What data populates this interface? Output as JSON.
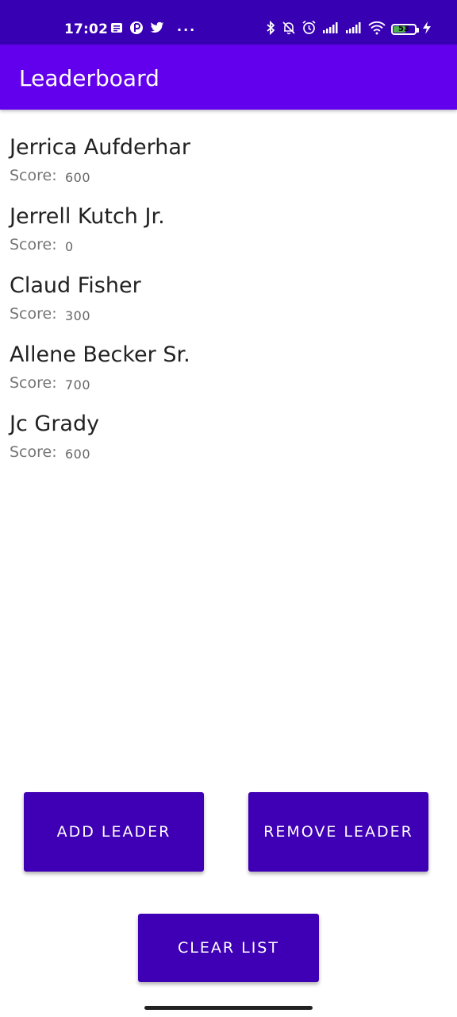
{
  "status_bar": {
    "time": "17:02",
    "battery_level": "53",
    "icons_left": [
      "notes-icon",
      "app-icon",
      "twitter-icon",
      "more-icon"
    ],
    "icons_right": [
      "bluetooth-icon",
      "mute-icon",
      "alarm-icon",
      "signal-icon",
      "signal-icon",
      "wifi-icon",
      "battery-icon",
      "charging-icon"
    ],
    "more_text": "···"
  },
  "app_bar": {
    "title": "Leaderboard"
  },
  "leaders": [
    {
      "name": "Jerrica Aufderhar",
      "score_label": "Score:",
      "score": "600"
    },
    {
      "name": "Jerrell Kutch Jr.",
      "score_label": "Score:",
      "score": "0"
    },
    {
      "name": "Claud Fisher",
      "score_label": "Score:",
      "score": "300"
    },
    {
      "name": "Allene Becker Sr.",
      "score_label": "Score:",
      "score": "700"
    },
    {
      "name": "Jc Grady",
      "score_label": "Score:",
      "score": "600"
    }
  ],
  "actions": {
    "add_label": "ADD LEADER",
    "remove_label": "REMOVE LEADER",
    "clear_label": "CLEAR LIST"
  },
  "colors": {
    "status_bar": "#3700b3",
    "app_bar": "#6200ee",
    "button": "#3f00b5"
  }
}
